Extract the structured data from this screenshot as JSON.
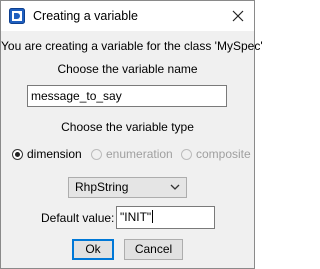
{
  "window": {
    "title": "Creating a variable",
    "icon": "rhapsody-app-icon",
    "close_icon": "close-icon"
  },
  "intro": "You are creating a variable for the class 'MySpec'",
  "name_section": {
    "heading": "Choose the variable name",
    "value": "message_to_say"
  },
  "type_section": {
    "heading": "Choose the variable type",
    "options": [
      {
        "label": "dimension",
        "selected": true,
        "enabled": true
      },
      {
        "label": "enumeration",
        "selected": false,
        "enabled": false
      },
      {
        "label": "composite",
        "selected": false,
        "enabled": false
      }
    ]
  },
  "type_select": {
    "value": "RhpString",
    "icon": "chevron-down-icon"
  },
  "default_value": {
    "label": "Default value:",
    "value": "\"INIT\""
  },
  "buttons": {
    "ok": "Ok",
    "cancel": "Cancel"
  },
  "colors": {
    "accent": "#0078d7",
    "dialog_bg": "#f0f0f0",
    "titlebar_bg": "#ffffff",
    "disabled_text": "#a0a0a0"
  }
}
